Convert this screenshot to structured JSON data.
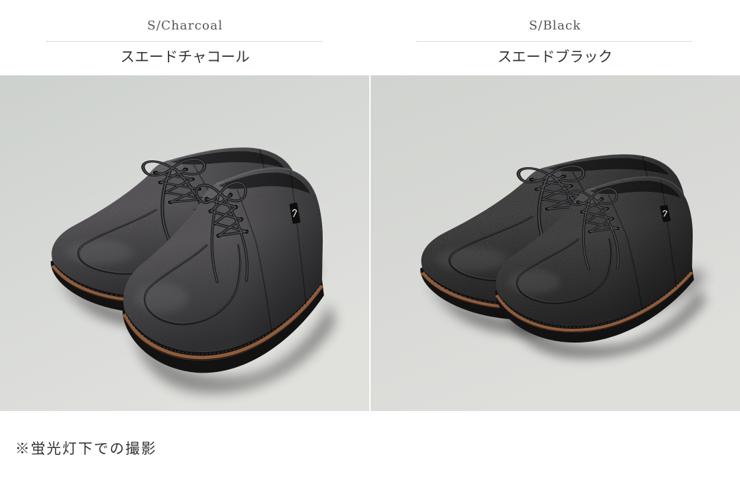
{
  "variants": [
    {
      "code": "S/Charcoal",
      "name": "スエードチャコール",
      "shoe_color": "#3c3b3f"
    },
    {
      "code": "S/Black",
      "name": "スエードブラック",
      "shoe_color": "#161616"
    }
  ],
  "note": "※蛍光灯下での撮影",
  "colors": {
    "page_background": "#ffffff",
    "photo_background": "#d9dbd8",
    "divider": "#b8b8b8",
    "text": "#333333",
    "sole": "#121212",
    "welt": "#8e5c3c"
  }
}
